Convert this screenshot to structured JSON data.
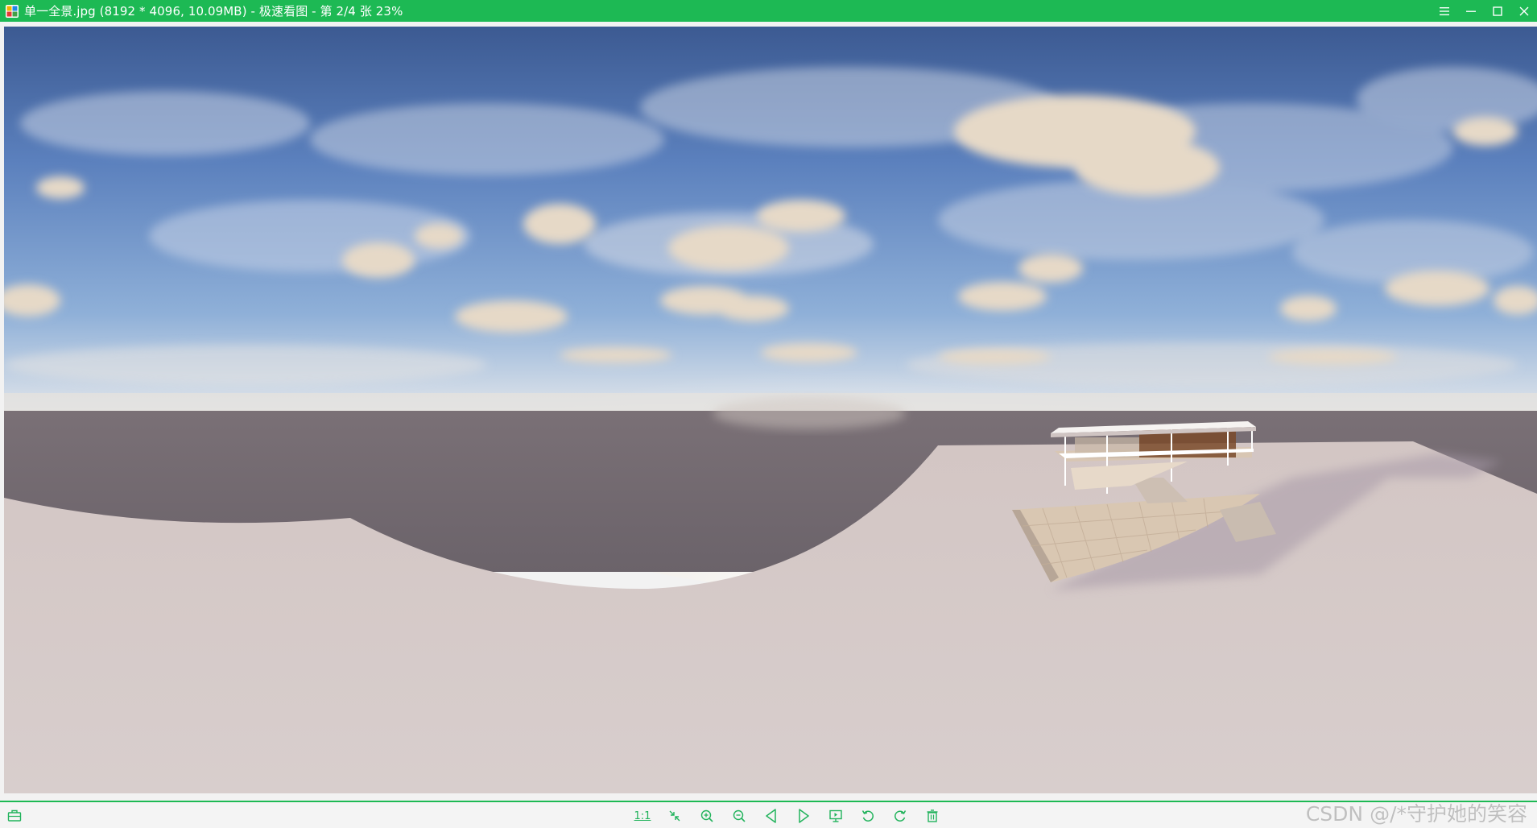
{
  "window": {
    "title": "单一全景.jpg (8192 * 4096, 10.09MB) - 极速看图 - 第 2/4 张 23%",
    "controls": [
      {
        "name": "menu-icon"
      },
      {
        "name": "minimize-icon"
      },
      {
        "name": "maximize-icon"
      },
      {
        "name": "close-icon"
      }
    ]
  },
  "colors": {
    "accent": "#1db954",
    "icon": "#22b35c",
    "sky_top": "#3d5f9c",
    "ground_dark": "#6f686f",
    "ground_light": "#d6cccc"
  },
  "viewer": {
    "image_description_icon": "panorama-image",
    "zoom_percent": 23,
    "image_index": 2,
    "image_total": 4
  },
  "toolbar": {
    "left_icon": "toolbox-icon",
    "actual_size_label": "1:1",
    "buttons": [
      "actual-size-button",
      "fit-window-button",
      "zoom-in-button",
      "zoom-out-button",
      "previous-button",
      "next-button",
      "slideshow-button",
      "rotate-left-button",
      "rotate-right-button",
      "delete-button"
    ]
  },
  "watermark": {
    "text": "CSDN @/*守护她的笑容"
  }
}
